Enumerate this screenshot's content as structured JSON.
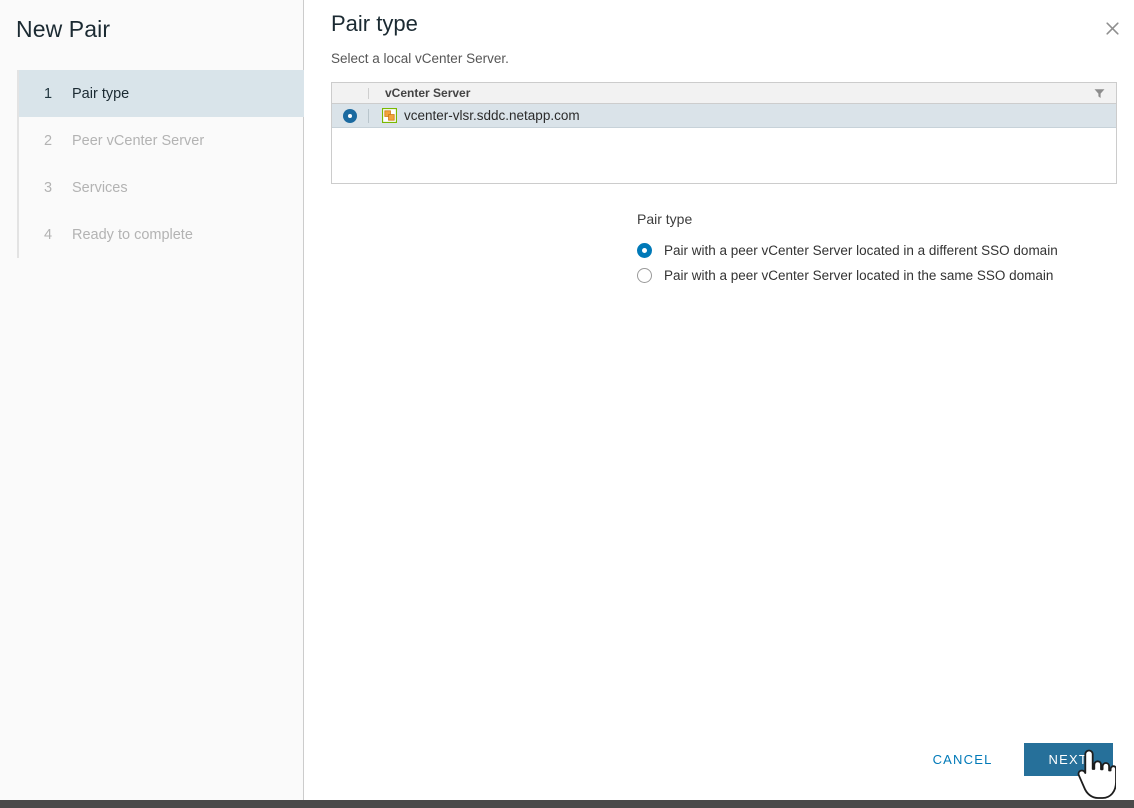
{
  "wizard": {
    "title": "New Pair",
    "steps": [
      {
        "num": "1",
        "label": "Pair type"
      },
      {
        "num": "2",
        "label": "Peer vCenter Server"
      },
      {
        "num": "3",
        "label": "Services"
      },
      {
        "num": "4",
        "label": "Ready to complete"
      }
    ]
  },
  "page": {
    "title": "Pair type",
    "subtitle": "Select a local vCenter Server.",
    "close_icon": "close-icon"
  },
  "grid": {
    "columns": [
      "",
      "vCenter Server"
    ],
    "filter_icon": "filter-icon",
    "rows": [
      {
        "selected": true,
        "icon": "vcenter-server-icon",
        "name": "vcenter-vlsr.sddc.netapp.com"
      }
    ]
  },
  "pair_type": {
    "label": "Pair type",
    "options": [
      {
        "label": "Pair with a peer vCenter Server located in a different SSO domain",
        "checked": true
      },
      {
        "label": "Pair with a peer vCenter Server located in the same SSO domain",
        "checked": false
      }
    ]
  },
  "footer": {
    "cancel_label": "CANCEL",
    "next_label": "NEXT"
  },
  "colors": {
    "accent": "#0079b8",
    "primary_button": "#26709a",
    "selected_row": "#dae3e9",
    "active_step": "#d9e4ea",
    "taskbar": "#4a4a4a"
  }
}
